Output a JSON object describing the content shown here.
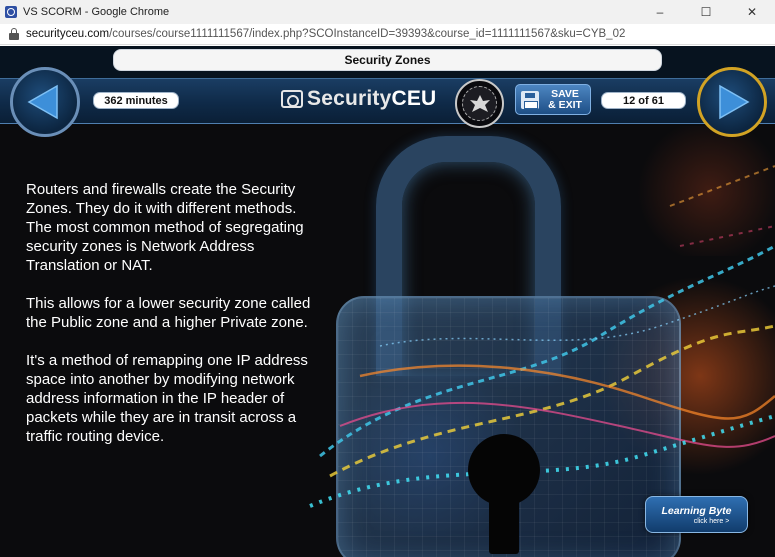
{
  "window": {
    "title": "VS SCORM - Google Chrome",
    "minimize_glyph": "–",
    "maximize_glyph": "☐",
    "close_glyph": "✕"
  },
  "address_bar": {
    "domain": "securityceu.com",
    "path": "/courses/course1111111567/index.php?SCOInstanceID=39393&course_id=1111111567&sku=CYB_02"
  },
  "course": {
    "slide_title": "Security Zones",
    "time_remaining": "362 minutes",
    "page_indicator": "12 of 61",
    "logo_prefix": "Security",
    "logo_suffix": "CEU",
    "save_exit_label": "SAVE\n& EXIT",
    "learning_byte_title": "Learning Byte",
    "learning_byte_sub": "click here >"
  },
  "slide": {
    "paragraphs": [
      "Routers and firewalls create the Security Zones. They do it with different methods. The most common method of segregating security zones is Network Address Translation or NAT.",
      "This allows for a lower security zone called the Public zone and a higher Private zone.",
      "It's a method of remapping one IP address space into another by modifying network address information in the IP header of packets while they are in transit across a traffic routing device."
    ]
  },
  "icons": {
    "prev": "left-arrow-icon",
    "next": "right-arrow-icon",
    "save": "floppy-disk-icon",
    "lock": "lock-icon",
    "seal": "eagle-seal-icon"
  },
  "colors": {
    "stage_bg": "#0b0b0d",
    "nav_band": "#1a3d63",
    "arrow_blue": "#3d8fd9",
    "next_ring": "#d2a324"
  }
}
